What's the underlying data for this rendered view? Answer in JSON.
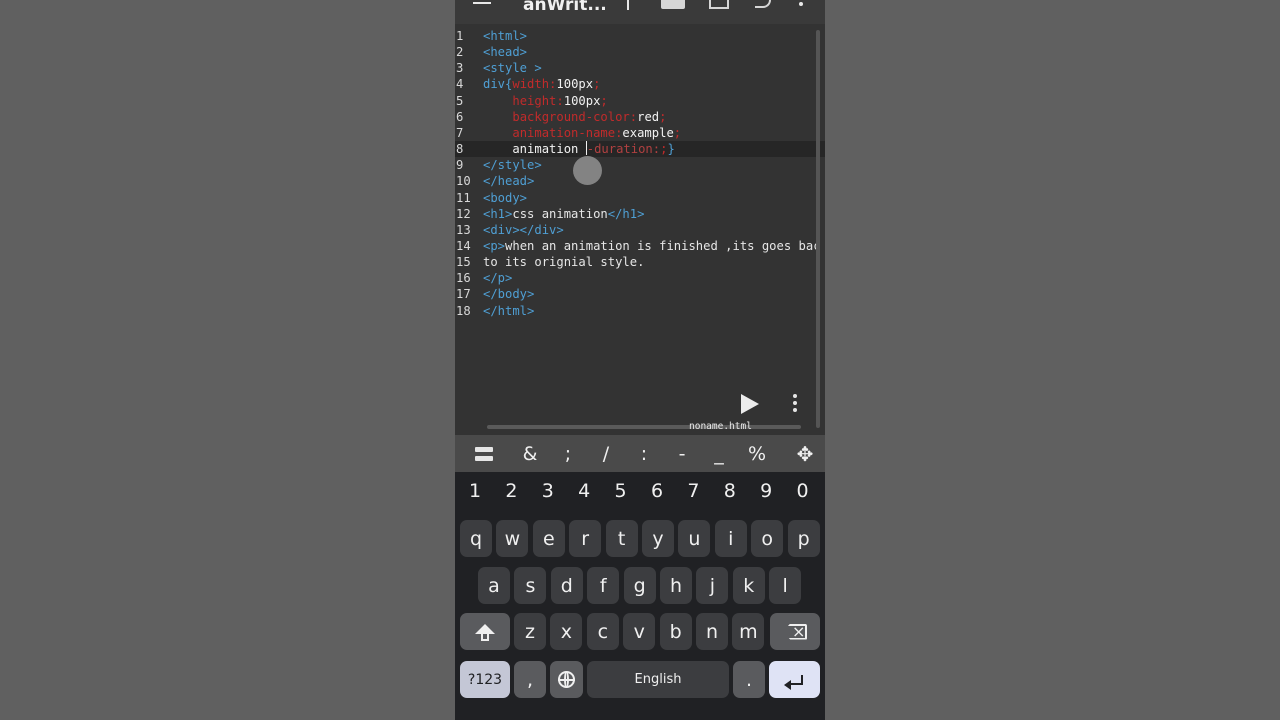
{
  "app": {
    "title": "anWrit...",
    "filename": "noname.html"
  },
  "editor": {
    "lines": [
      {
        "n": "1",
        "segs": [
          {
            "c": "t",
            "s": "<html>"
          }
        ]
      },
      {
        "n": "2",
        "segs": [
          {
            "c": "t",
            "s": "<head>"
          }
        ]
      },
      {
        "n": "3",
        "segs": [
          {
            "c": "t",
            "s": "<style >"
          }
        ]
      },
      {
        "n": "4",
        "segs": [
          {
            "c": "t",
            "s": "div{"
          },
          {
            "c": "p",
            "s": "width:"
          },
          {
            "c": "v",
            "s": "100px"
          },
          {
            "c": "p",
            "s": ";"
          }
        ]
      },
      {
        "n": "5",
        "segs": [
          {
            "c": "v",
            "s": "    "
          },
          {
            "c": "p",
            "s": "height:"
          },
          {
            "c": "v",
            "s": "100px"
          },
          {
            "c": "p",
            "s": ";"
          }
        ]
      },
      {
        "n": "6",
        "segs": [
          {
            "c": "v",
            "s": "    "
          },
          {
            "c": "p",
            "s": "background-color:"
          },
          {
            "c": "v",
            "s": "red"
          },
          {
            "c": "p",
            "s": ";"
          }
        ]
      },
      {
        "n": "7",
        "segs": [
          {
            "c": "v",
            "s": "    "
          },
          {
            "c": "p",
            "s": "animation-name:"
          },
          {
            "c": "v",
            "s": "example"
          },
          {
            "c": "p",
            "s": ";"
          }
        ]
      },
      {
        "n": "8",
        "active": true,
        "segs": [
          {
            "c": "v",
            "s": "    animation "
          },
          {
            "c": "caret",
            "s": ""
          },
          {
            "c": "d",
            "s": "-duration:"
          },
          {
            "c": "p",
            "s": ";"
          },
          {
            "c": "t",
            "s": "}"
          }
        ]
      },
      {
        "n": "9",
        "segs": [
          {
            "c": "t",
            "s": "</style>"
          }
        ]
      },
      {
        "n": "10",
        "segs": [
          {
            "c": "t",
            "s": "</head>"
          }
        ]
      },
      {
        "n": "11",
        "segs": [
          {
            "c": "t",
            "s": "<body>"
          }
        ]
      },
      {
        "n": "12",
        "segs": [
          {
            "c": "t",
            "s": "<h1>"
          },
          {
            "c": "txt",
            "s": "css animation"
          },
          {
            "c": "t",
            "s": "</h1>"
          }
        ]
      },
      {
        "n": "13",
        "segs": [
          {
            "c": "t",
            "s": "<div></div>"
          }
        ]
      },
      {
        "n": "14",
        "segs": [
          {
            "c": "t",
            "s": "<p>"
          },
          {
            "c": "txt",
            "s": "when an animation is finished ,its goes bac"
          }
        ]
      },
      {
        "n": "15",
        "segs": [
          {
            "c": "txt",
            "s": "to its orignial style."
          }
        ]
      },
      {
        "n": "16",
        "segs": [
          {
            "c": "t",
            "s": "</p>"
          }
        ]
      },
      {
        "n": "17",
        "segs": [
          {
            "c": "t",
            "s": "</body>"
          }
        ]
      },
      {
        "n": "18",
        "segs": [
          {
            "c": "t",
            "s": "</html>"
          }
        ]
      }
    ]
  },
  "icons": {
    "run": "play-icon",
    "more": "more-vert-icon",
    "menu": "hamburger-icon",
    "folder": "folder-icon",
    "save": "save-icon",
    "undo": "undo-icon",
    "list": "list-icon",
    "move": "move-arrows-icon"
  },
  "symbols": [
    "&",
    ";",
    "/",
    ":",
    "-",
    "_",
    "%"
  ],
  "symbols_extra": {
    "move": "✥"
  },
  "keyboard": {
    "numbers": [
      "1",
      "2",
      "3",
      "4",
      "5",
      "6",
      "7",
      "8",
      "9",
      "0"
    ],
    "row1": [
      "q",
      "w",
      "e",
      "r",
      "t",
      "y",
      "u",
      "i",
      "o",
      "p"
    ],
    "row2": [
      "a",
      "s",
      "d",
      "f",
      "g",
      "h",
      "j",
      "k",
      "l"
    ],
    "row3": [
      "z",
      "x",
      "c",
      "v",
      "b",
      "n",
      "m"
    ],
    "mode_label": "?123",
    "comma": ",",
    "space_label": "English",
    "period": "."
  },
  "colors": {
    "tag": "#4f9fd4",
    "property": "#c12b2b",
    "value": "#f2f2f2",
    "editor_bg": "#333333",
    "keyboard_bg": "#202124"
  }
}
